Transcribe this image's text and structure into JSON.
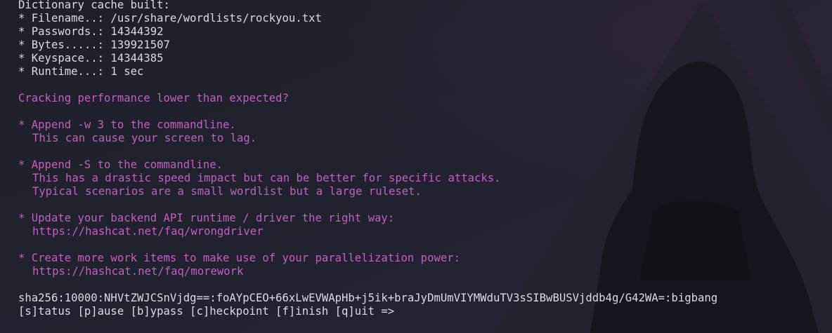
{
  "terminal": {
    "cache": {
      "header": "Dictionary cache built:",
      "filename": "* Filename..: /usr/share/wordlists/rockyou.txt",
      "passwords": "* Passwords.: 14344392",
      "bytes": "* Bytes.....: 139921507",
      "keyspace": "* Keyspace..: 14344385",
      "runtime": "* Runtime...: 1 sec"
    },
    "warning": {
      "title": "Cracking performance lower than expected?",
      "tips": [
        {
          "head": "* Append -w 3 to the commandline.",
          "lines": [
            "This can cause your screen to lag."
          ]
        },
        {
          "head": "* Append -S to the commandline.",
          "lines": [
            "This has a drastic speed impact but can be better for specific attacks.",
            "Typical scenarios are a small wordlist but a large ruleset."
          ]
        },
        {
          "head": "* Update your backend API runtime / driver the right way:",
          "lines": [
            "https://hashcat.net/faq/wrongdriver"
          ]
        },
        {
          "head": "* Create more work items to make use of your parallelization power:",
          "lines": [
            "https://hashcat.net/faq/morework"
          ]
        }
      ]
    },
    "result": "sha256:10000:NHVtZWJCSnVjdg==:foAYpCEO+66xLwEVWApHb+j5ik+braJyDmUmVIYMWduTV3sSIBwBUSVjddb4g/G42WA=:bigbang",
    "prompt": "[s]tatus [p]ause [b]ypass [c]heckpoint [f]inish [q]uit =>"
  },
  "colors": {
    "background": "#1f212b",
    "text": "#dadce4",
    "warning": "#c55fc4"
  }
}
